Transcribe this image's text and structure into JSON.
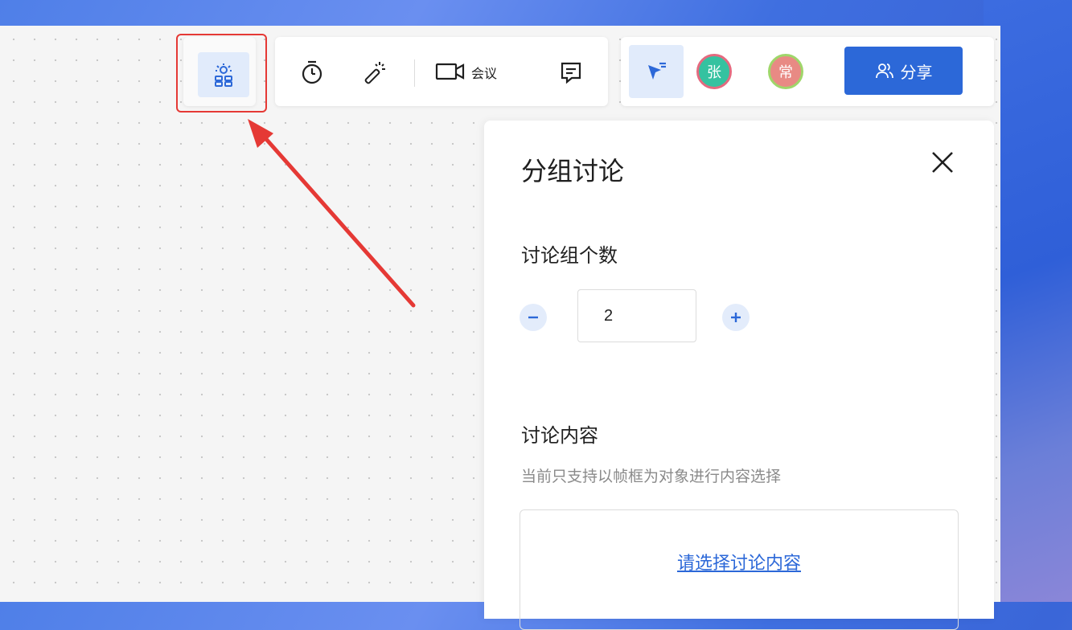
{
  "toolbar": {
    "meeting_label": "会议",
    "share_label": "分享"
  },
  "avatars": [
    {
      "initial": "张",
      "color": "#35c2a0"
    },
    {
      "initial": "常",
      "color": "#e88a84"
    }
  ],
  "panel": {
    "title": "分组讨论",
    "group_count_label": "讨论组个数",
    "group_count_value": "2",
    "content_label": "讨论内容",
    "content_hint": "当前只支持以帧框为对象进行内容选择",
    "select_content_link": "请选择讨论内容"
  },
  "colors": {
    "accent": "#2c68d8",
    "highlight": "#e53935"
  },
  "icons": [
    "brainstorm-icon",
    "timer-icon",
    "magic-wand-icon",
    "video-camera-icon",
    "comment-icon",
    "pointer-icon",
    "share-users-icon",
    "close-icon",
    "minus-icon",
    "plus-icon"
  ]
}
